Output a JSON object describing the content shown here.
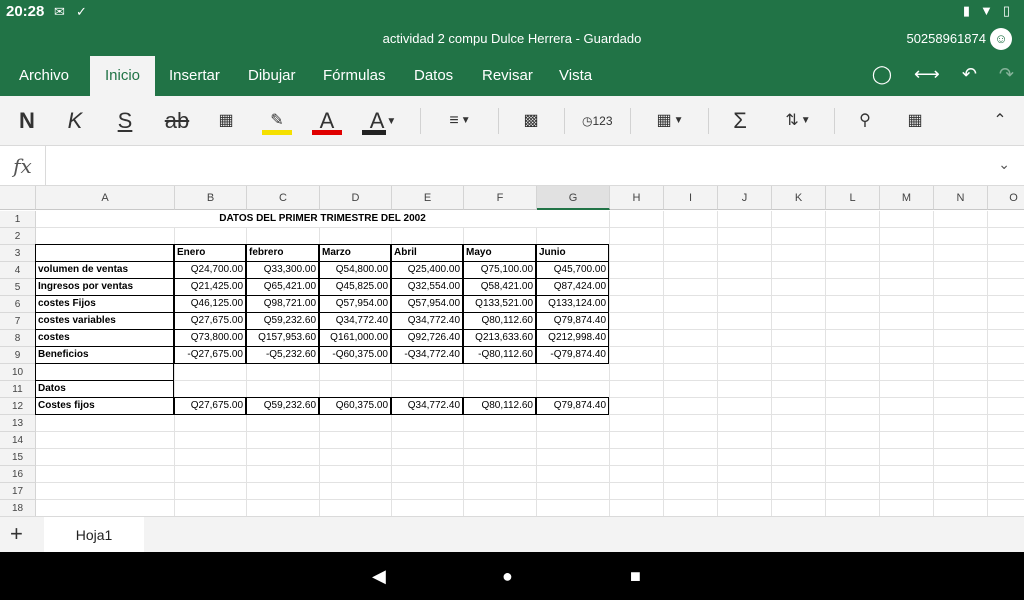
{
  "status": {
    "time": "20:28",
    "notif_icons": [
      "mail-icon",
      "check-icon"
    ],
    "right_icons": [
      "vibrate-icon",
      "wifi-icon",
      "battery-icon"
    ]
  },
  "title": {
    "doc": "actividad 2 compu Dulce Herrera - Guardado",
    "phone": "50258961874"
  },
  "tabs": [
    "Archivo",
    "Inicio",
    "Insertar",
    "Dibujar",
    "Fórmulas",
    "Datos",
    "Revisar",
    "Vista"
  ],
  "active_tab": "Inicio",
  "ribbon": {
    "bold": "N",
    "italic": "K",
    "underline": "S",
    "strike": "ab",
    "highlight_color": "#f5e000",
    "font_color": "#e00000",
    "autonumber": "123"
  },
  "formula_bar": {
    "fx": "fx",
    "value": ""
  },
  "columns": [
    "A",
    "B",
    "C",
    "D",
    "E",
    "F",
    "G",
    "H",
    "I",
    "J",
    "K",
    "L",
    "M",
    "N",
    "O"
  ],
  "selected_column": "G",
  "rows": [
    "1",
    "2",
    "3",
    "4",
    "5",
    "6",
    "7",
    "8",
    "9",
    "10",
    "11",
    "12",
    "13",
    "14",
    "15",
    "16",
    "17",
    "18"
  ],
  "sheet": {
    "title": "DATOS DEL PRIMER TRIMESTRE DEL 2002",
    "headers": [
      "Enero",
      "febrero",
      "Marzo",
      "Abril",
      "Mayo",
      "Junio"
    ],
    "data_rows": [
      {
        "label": "volumen de ventas",
        "values": [
          "Q24,700.00",
          "Q33,300.00",
          "Q54,800.00",
          "Q25,400.00",
          "Q75,100.00",
          "Q45,700.00"
        ]
      },
      {
        "label": "Ingresos por ventas",
        "values": [
          "Q21,425.00",
          "Q65,421.00",
          "Q45,825.00",
          "Q32,554.00",
          "Q58,421.00",
          "Q87,424.00"
        ]
      },
      {
        "label": "costes Fijos",
        "values": [
          "Q46,125.00",
          "Q98,721.00",
          "Q57,954.00",
          "Q57,954.00",
          "Q133,521.00",
          "Q133,124.00"
        ]
      },
      {
        "label": "costes variables",
        "values": [
          "Q27,675.00",
          "Q59,232.60",
          "Q34,772.40",
          "Q34,772.40",
          "Q80,112.60",
          "Q79,874.40"
        ]
      },
      {
        "label": "costes",
        "values": [
          "Q73,800.00",
          "Q157,953.60",
          "Q161,000.00",
          "Q92,726.40",
          "Q213,633.60",
          "Q212,998.40"
        ]
      },
      {
        "label": "Beneficios",
        "values": [
          "-Q27,675.00",
          "-Q5,232.60",
          "-Q60,375.00",
          "-Q34,772.40",
          "-Q80,112.60",
          "-Q79,874.40"
        ]
      }
    ],
    "datos_label": "Datos",
    "costes_row": {
      "label": "Costes fijos",
      "values": [
        "Q27,675.00",
        "Q59,232.60",
        "Q60,375.00",
        "Q34,772.40",
        "Q80,112.60",
        "Q79,874.40"
      ]
    }
  },
  "sheet_tab": "Hoja1"
}
